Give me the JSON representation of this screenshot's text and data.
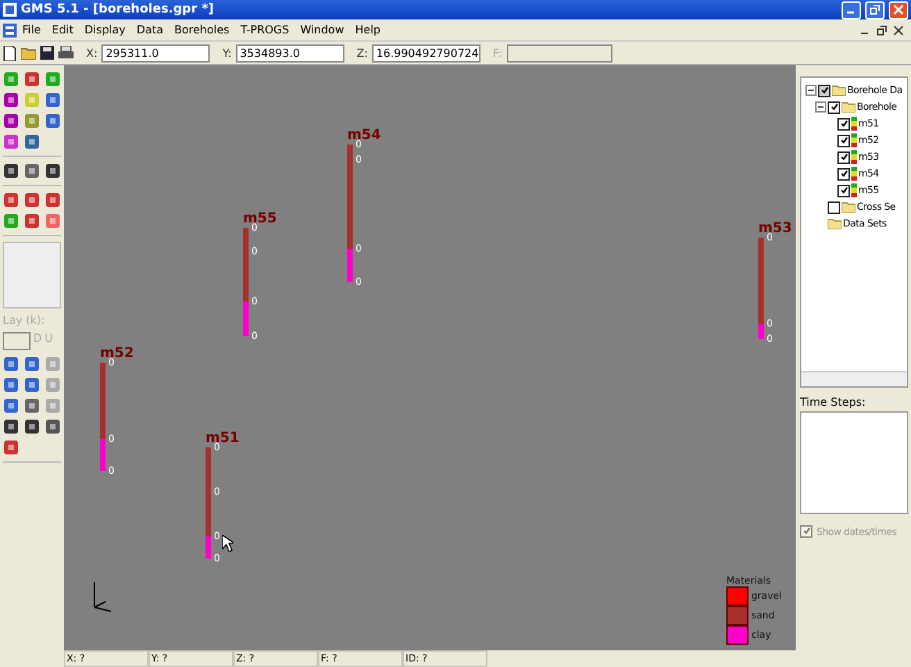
{
  "window": {
    "title": "GMS 5.1 - [boreholes.gpr *]"
  },
  "menu": [
    "File",
    "Edit",
    "Display",
    "Data",
    "Boreholes",
    "T-PROGS",
    "Window",
    "Help"
  ],
  "coords": [
    {
      "label": "X:",
      "value": "295311.0"
    },
    {
      "label": "Y:",
      "value": "3534893.0"
    },
    {
      "label": "Z:",
      "value": "16.990492790724"
    },
    {
      "label": "F:",
      "disabled": true
    }
  ],
  "toolbox": {
    "layer_label": "Lay (k):",
    "down": "D",
    "up": "U"
  },
  "materials": [
    {
      "name": "gravel",
      "color": "#ff0000"
    },
    {
      "name": "sand",
      "color": "#a8302c"
    },
    {
      "name": "clay",
      "color": "#ff00cc"
    }
  ],
  "legend_title": "Materials",
  "boreholes": [
    {
      "name": "m54",
      "segments": [
        {
          "color": "#a8302c",
          "label": "0"
        },
        {
          "color": "#a8302c",
          "label": "0"
        },
        {
          "color": "#ff00cc",
          "label": "0"
        }
      ],
      "bottom_label": "0"
    },
    {
      "name": "m55",
      "segments": [
        {
          "color": "#a8302c",
          "label": "0"
        },
        {
          "color": "#a8302c",
          "label": "0"
        },
        {
          "color": "#ff00cc",
          "label": "0"
        }
      ],
      "bottom_label": "0"
    },
    {
      "name": "m53",
      "segments": [
        {
          "color": "#a8302c",
          "label": "0"
        },
        {
          "color": "#ff00cc",
          "label": "0"
        }
      ],
      "bottom_label": "0"
    },
    {
      "name": "m52",
      "segments": [
        {
          "color": "#a8302c",
          "label": "0"
        },
        {
          "color": "#ff00cc",
          "label": "0"
        }
      ],
      "bottom_label": "0"
    },
    {
      "name": "m51",
      "segments": [
        {
          "color": "#a8302c",
          "label": "0"
        },
        {
          "color": "#a8302c",
          "label": "0"
        },
        {
          "color": "#ff00cc",
          "label": "0"
        }
      ],
      "bottom_label": "0"
    }
  ],
  "tree": [
    {
      "label": "Borehole Da",
      "kind": "folder",
      "checked": true,
      "partial": true,
      "expanded": true,
      "children": [
        {
          "label": "Borehole",
          "kind": "folder",
          "checked": true,
          "expanded": true,
          "children": [
            {
              "label": "m51",
              "kind": "borehole",
              "checked": true
            },
            {
              "label": "m52",
              "kind": "borehole",
              "checked": true
            },
            {
              "label": "m53",
              "kind": "borehole",
              "checked": true
            },
            {
              "label": "m54",
              "kind": "borehole",
              "checked": true
            },
            {
              "label": "m55",
              "kind": "borehole",
              "checked": true
            }
          ]
        },
        {
          "label": "Cross Se",
          "kind": "folder",
          "checked": false
        },
        {
          "label": "Data Sets",
          "kind": "folder"
        }
      ]
    }
  ],
  "time_steps": {
    "label": "Time Steps:"
  },
  "show_dates": {
    "label": "Show dates/times",
    "checked": true,
    "disabled": true
  },
  "status_bar": [
    "X: ?",
    "Y: ?",
    "Z: ?",
    "F: ?",
    "ID: ?"
  ]
}
